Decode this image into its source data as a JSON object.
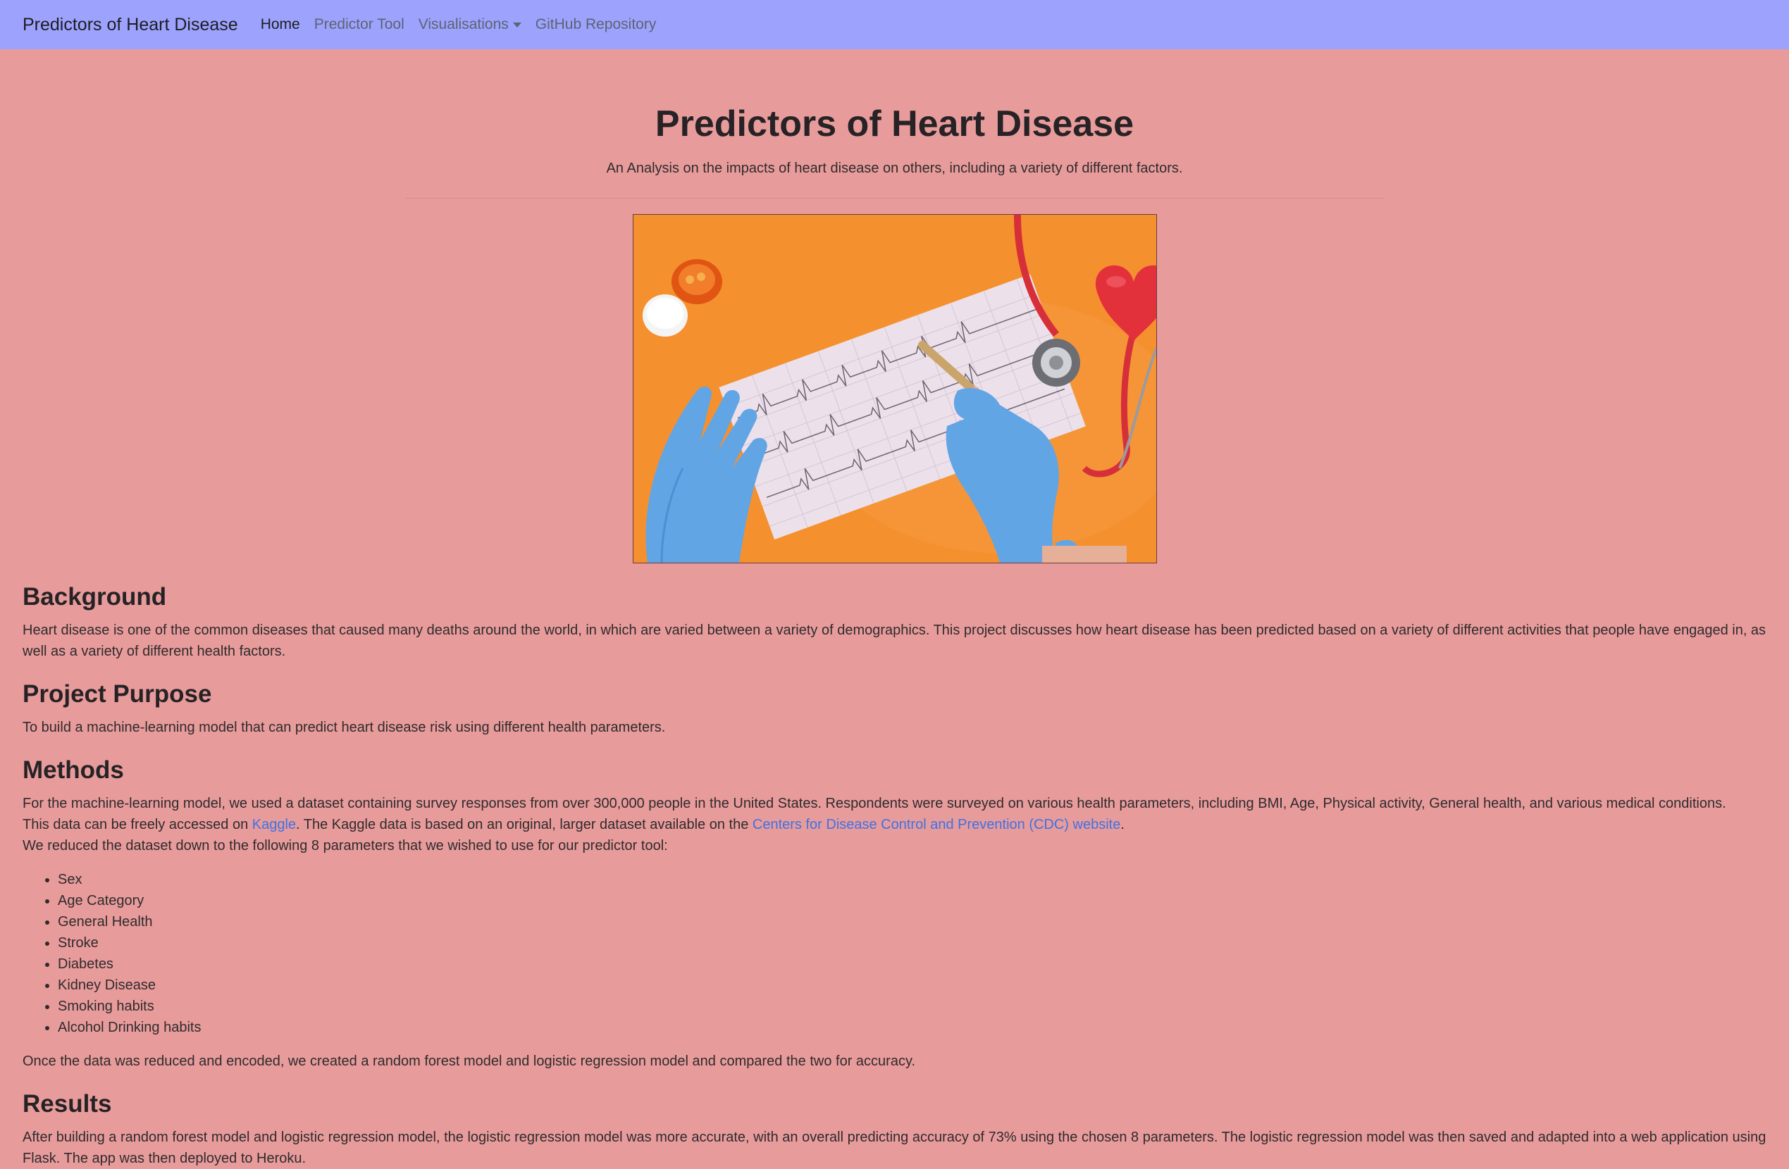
{
  "nav": {
    "brand": "Predictors of Heart Disease",
    "home": "Home",
    "predictor_tool": "Predictor Tool",
    "visualisations": "Visualisations",
    "github": "GitHub Repository"
  },
  "hero": {
    "title": "Predictors of Heart Disease",
    "subtitle": "An Analysis on the impacts of heart disease on others, including a variety of different factors."
  },
  "background": {
    "heading": "Background",
    "text": "Heart disease is one of the common diseases that caused many deaths around the world, in which are varied between a variety of demographics. This project discusses how heart disease has been predicted based on a variety of different activities that people have engaged in, as well as a variety of different health factors."
  },
  "purpose": {
    "heading": "Project Purpose",
    "text": "To build a machine-learning model that can predict heart disease risk using different health parameters."
  },
  "methods": {
    "heading": "Methods",
    "line1": "For the machine-learning model, we used a dataset containing survey responses from over 300,000 people in the United States. Respondents were surveyed on various health parameters, including BMI, Age, Physical activity, General health, and various medical conditions.",
    "line2_pre": "This data can be freely accessed on ",
    "kaggle_link": "Kaggle",
    "line2_mid": ". The Kaggle data is based on an original, larger dataset available on the ",
    "cdc_link": "Centers for Disease Control and Prevention (CDC) website",
    "line2_post": ".",
    "line3": "We reduced the dataset down to the following 8 parameters that we wished to use for our predictor tool:",
    "params": [
      "Sex",
      "Age Category",
      "General Health",
      "Stroke",
      "Diabetes",
      "Kidney Disease",
      "Smoking habits",
      "Alcohol Drinking habits"
    ],
    "closing": "Once the data was reduced and encoded, we created a random forest model and logistic regression model and compared the two for accuracy."
  },
  "results": {
    "heading": "Results",
    "text": "After building a random forest model and logistic regression model, the logistic regression model was more accurate, with an overall predicting accuracy of 73% using the chosen 8 parameters. The logistic regression model was then saved and adapted into a web application using Flask. The app was then deployed to Heroku."
  },
  "colors": {
    "navbar": "#9da3fd",
    "page_bg": "#e89b9b",
    "link": "#3e72e6"
  }
}
